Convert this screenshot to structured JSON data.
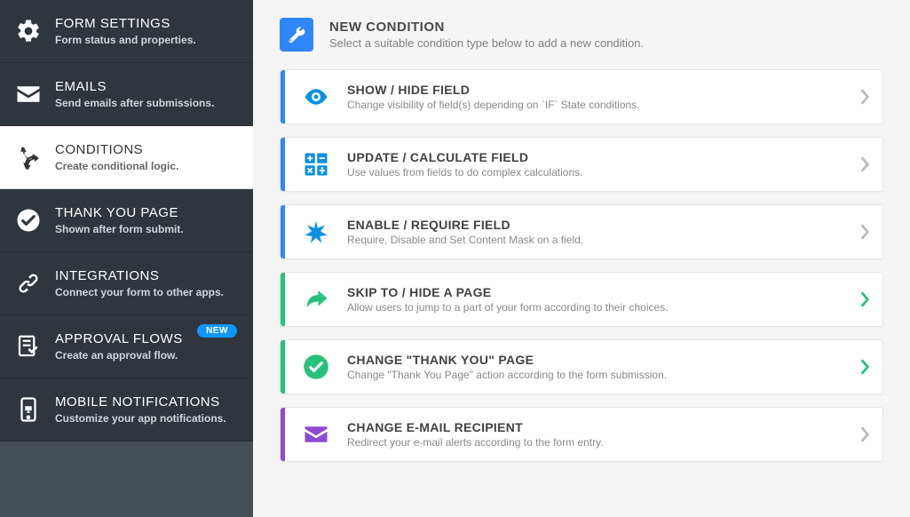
{
  "sidebar": {
    "items": [
      {
        "title": "FORM SETTINGS",
        "desc": "Form status and properties."
      },
      {
        "title": "EMAILS",
        "desc": "Send emails after submissions."
      },
      {
        "title": "CONDITIONS",
        "desc": "Create conditional logic."
      },
      {
        "title": "THANK YOU PAGE",
        "desc": "Shown after form submit."
      },
      {
        "title": "INTEGRATIONS",
        "desc": "Connect your form to other apps."
      },
      {
        "title": "APPROVAL FLOWS",
        "desc": "Create an approval flow.",
        "badge": "NEW"
      },
      {
        "title": "MOBILE NOTIFICATIONS",
        "desc": "Customize your app notifications."
      }
    ]
  },
  "header": {
    "title": "NEW CONDITION",
    "desc": "Select a suitable condition type below to add a new condition."
  },
  "cards": [
    {
      "title": "SHOW / HIDE FIELD",
      "desc": "Change visibility of field(s) depending on `IF` State conditions.",
      "accent": "#2f86ff",
      "iconColor": "#0b90e3"
    },
    {
      "title": "UPDATE / CALCULATE FIELD",
      "desc": "Use values from fields to do complex calculations.",
      "accent": "#2f86ff",
      "iconColor": "#0b90e3"
    },
    {
      "title": "ENABLE / REQUIRE FIELD",
      "desc": "Require, Disable and Set Content Mask on a field.",
      "accent": "#2f86ff",
      "iconColor": "#0b90e3"
    },
    {
      "title": "SKIP TO / HIDE A PAGE",
      "desc": "Allow users to jump to a part of your form according to their choices.",
      "accent": "#27c27b",
      "iconColor": "#27c27b",
      "chevron": "#27c27b"
    },
    {
      "title": "CHANGE \"THANK YOU\" PAGE",
      "desc": "Change \"Thank You Page\" action according to the form submission.",
      "accent": "#27c27b",
      "iconColor": "#27c27b",
      "chevron": "#27c27b"
    },
    {
      "title": "CHANGE E-MAIL RECIPIENT",
      "desc": "Redirect your e-mail alerts according to the form entry.",
      "accent": "#8d4bd4",
      "iconColor": "#8d4bd4"
    }
  ]
}
